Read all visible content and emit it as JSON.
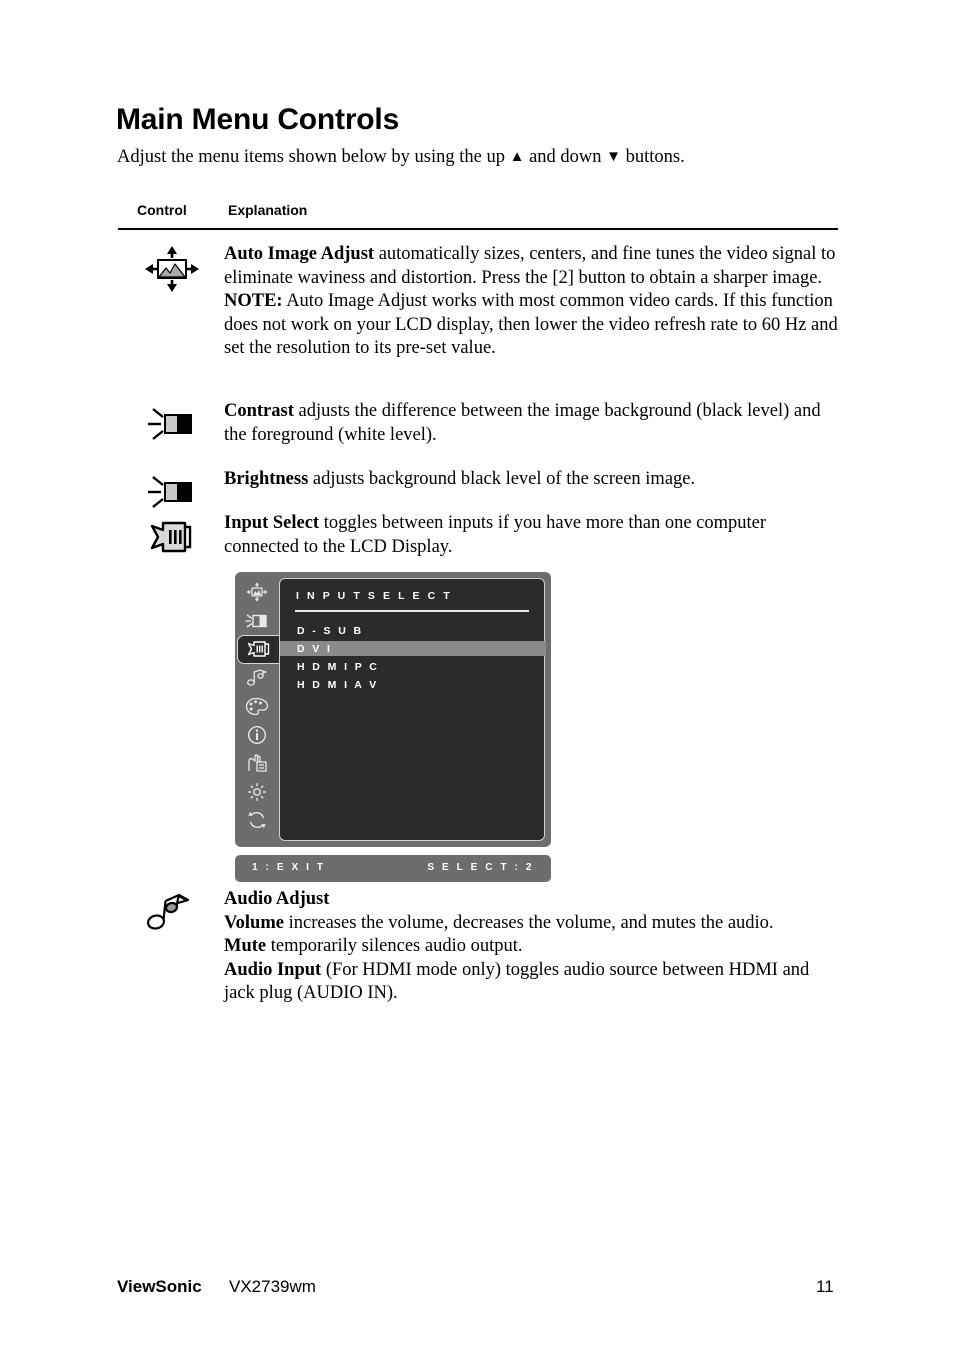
{
  "page": {
    "title": "Main Menu Controls",
    "intro_before": "Adjust the menu items shown below by using the up ",
    "intro_up_glyph": "▲",
    "intro_middle": " and down ",
    "intro_down_glyph": "▼",
    "intro_after": " buttons."
  },
  "table": {
    "header": {
      "control": "Control",
      "explanation": "Explanation"
    },
    "rows": [
      {
        "icon": "auto-image-adjust-icon",
        "term": "Auto Image Adjust",
        "body": " automatically sizes, centers, and fine tunes the video signal to eliminate waviness and distortion. Press the [2] button to obtain a sharper image.",
        "note_label": "NOTE:",
        "note_body": " Auto Image Adjust works with most common video cards. If this function does not work on your LCD display, then lower the video refresh rate to 60 Hz and set the resolution to its pre-set value."
      },
      {
        "icon": "contrast-icon",
        "term": "Contrast",
        "body": " adjusts the difference between the image background  (black level) and the foreground (white level)."
      },
      {
        "icon": "brightness-icon",
        "term": "Brightness",
        "body": " adjusts background black level of the screen image."
      },
      {
        "icon": "input-select-icon",
        "term": "Input Select",
        "body": " toggles between inputs if you have more than one computer connected to the LCD Display."
      }
    ],
    "audio_row": {
      "icon": "audio-adjust-icon",
      "heading": "Audio Adjust",
      "volume_term": "Volume",
      "volume_body": " increases the volume, decreases the volume, and mutes the audio.",
      "mute_term": "Mute",
      "mute_body": " temporarily silences audio output.",
      "audio_input_term": "Audio Input",
      "audio_input_body": " (For HDMI mode only) toggles audio source between HDMI and jack plug (AUDIO IN)."
    }
  },
  "osd": {
    "heading": "I N P U T    S E L E C T",
    "items": [
      {
        "label": "D - S U B",
        "selected": false
      },
      {
        "label": "D V I",
        "selected": true
      },
      {
        "label": "H D M I    P C",
        "selected": false
      },
      {
        "label": "H D M I    A V",
        "selected": false
      }
    ],
    "sidebar_icons": [
      "auto-image-adjust-icon",
      "contrast-brightness-icon",
      "input-select-icon",
      "audio-adjust-icon",
      "color-adjust-icon",
      "information-icon",
      "manual-image-adjust-icon",
      "setup-menu-icon",
      "memory-recall-icon"
    ],
    "selected_sidebar_index": 2,
    "footer_left": "1 : E X I T",
    "footer_right": "S E L E C T : 2",
    "colors": {
      "panel_gray": "#6d6d6d",
      "screen_dark": "#2b2b2b",
      "highlight_gray": "#8a8a8a",
      "text_white": "#ffffff"
    }
  },
  "footer": {
    "brand": "ViewSonic",
    "model": "VX2739wm",
    "page_number": "11"
  }
}
